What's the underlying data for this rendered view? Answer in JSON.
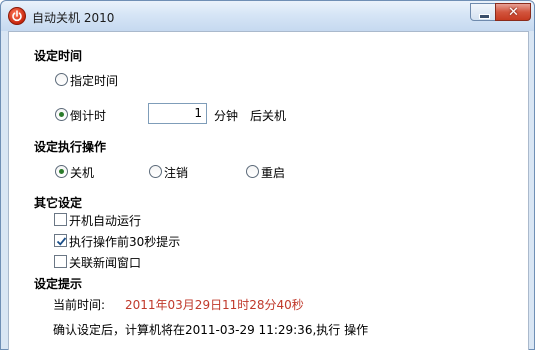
{
  "window": {
    "title": "自动关机 2010",
    "minimize_label": "–",
    "close_label": "✕"
  },
  "set_time": {
    "heading": "设定时间",
    "option_specified": "指定时间",
    "option_countdown": "倒计时",
    "minutes_value": "1",
    "minutes_unit": "分钟",
    "after_action": "后关机",
    "selected": "countdown"
  },
  "set_action": {
    "heading": "设定执行操作",
    "options": [
      "关机",
      "注销",
      "重启"
    ],
    "selected": "关机"
  },
  "other_settings": {
    "heading": "其它设定",
    "options": [
      {
        "label": "开机自动运行",
        "checked": false
      },
      {
        "label": "执行操作前30秒提示",
        "checked": true
      },
      {
        "label": "关联新闻窗口",
        "checked": false
      }
    ]
  },
  "prompt": {
    "heading": "设定提示",
    "current_time_label": "当前时间:",
    "current_date": "2011年03月29日",
    "current_clock": "11时28分40秒",
    "confirm_text": "确认设定后，计算机将在2011-03-29 11:29:36,执行  操作"
  },
  "colors": {
    "accent_red": "#c0392b",
    "titlebar": "#d6e5f6",
    "close_button": "#c63a20"
  },
  "icons": [
    "power-icon",
    "minimize-icon",
    "close-icon",
    "check-icon"
  ]
}
